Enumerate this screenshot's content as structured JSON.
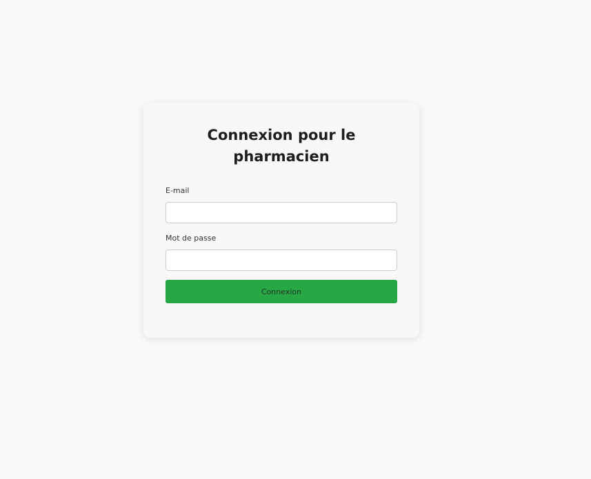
{
  "login": {
    "title": "Connexion pour le pharmacien",
    "email_label": "E-mail",
    "email_value": "",
    "password_label": "Mot de passe",
    "password_value": "",
    "submit_label": "Connexion"
  },
  "colors": {
    "page_background": "#f8f9fa",
    "card_background": "#f8f8f8",
    "submit_button": "#28a745"
  }
}
